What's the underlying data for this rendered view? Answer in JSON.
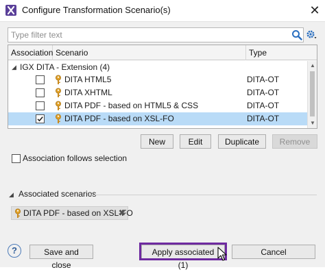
{
  "window": {
    "title": "Configure Transformation Scenario(s)",
    "close_glyph": "✕"
  },
  "filter": {
    "placeholder": "Type filter text",
    "value": ""
  },
  "table": {
    "columns": [
      "Association",
      "Scenario",
      "Type"
    ],
    "group": {
      "label": "IGX DITA - Extension (4)",
      "expanded": true
    },
    "rows": [
      {
        "scenario": "DITA HTML5",
        "type": "DITA-OT",
        "checked": false,
        "selected": false
      },
      {
        "scenario": "DITA XHTML",
        "type": "DITA-OT",
        "checked": false,
        "selected": false
      },
      {
        "scenario": "DITA PDF - based on HTML5 & CSS",
        "type": "DITA-OT",
        "checked": false,
        "selected": false
      },
      {
        "scenario": "DITA PDF - based on XSL-FO",
        "type": "DITA-OT",
        "checked": true,
        "selected": true
      }
    ]
  },
  "actions": {
    "new": "New",
    "edit": "Edit",
    "duplicate": "Duplicate",
    "remove": "Remove"
  },
  "follow_selection": {
    "label": "Association follows selection",
    "checked": false
  },
  "associated": {
    "title": "Associated scenarios",
    "chips": [
      {
        "label": "DITA PDF - based on XSL-FO"
      }
    ]
  },
  "footer": {
    "help": "?",
    "save_close": "Save and close",
    "apply": "Apply associated (1)",
    "cancel": "Cancel"
  },
  "colors": {
    "selection": "#b9dbf7",
    "highlight_frame": "#6e2aa0",
    "key_icon": "#e0a128",
    "app_icon": "#5a3f99"
  },
  "icons": {
    "app": "oxygen-x-icon",
    "search": "search-icon",
    "settings": "gear-icon",
    "scenario": "key-icon",
    "chip_remove": "close-icon",
    "help": "help-icon"
  }
}
